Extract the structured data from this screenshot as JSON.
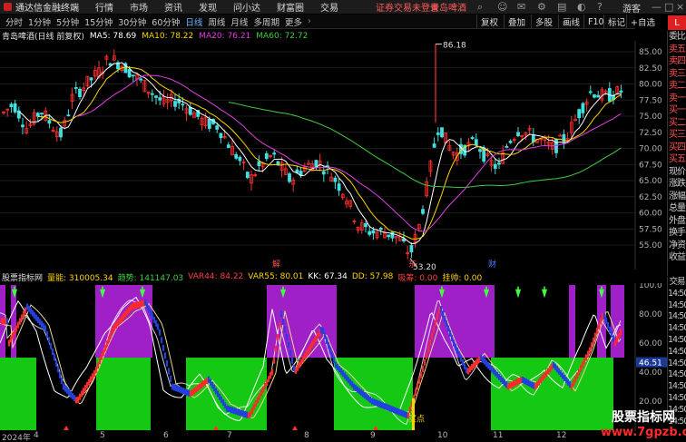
{
  "menubar": {
    "app_title": "通达信金融终端",
    "items": [
      "行情",
      "市场",
      "资讯",
      "发现",
      "问小达",
      "财富圈",
      "交易"
    ],
    "notice": "证券交易未登录",
    "stock_short": "青岛啤酒",
    "guest": "游客"
  },
  "toolbar": {
    "periods": [
      "分时",
      "1分钟",
      "5分钟",
      "15分钟",
      "30分钟",
      "60分钟",
      "日线",
      "周线",
      "月线",
      "多周期",
      "更多"
    ],
    "active_period": "日线",
    "right_buttons": [
      "复权",
      "叠加",
      "多股",
      "画线",
      "F10",
      "标记",
      "+自选"
    ]
  },
  "chart_info": {
    "stock_label": "青岛啤酒(日线 前复权)",
    "ma5": "MA5: 78.69",
    "ma10": "MA10: 78.22",
    "ma20": "MA20: 76.21",
    "ma60": "MA60: 72.72",
    "ma5_color": "#ffffff",
    "ma10_color": "#ffd400",
    "ma20_color": "#e040e0",
    "ma60_color": "#40d040"
  },
  "price_axis": [
    "85.00",
    "82.50",
    "80.00",
    "77.50",
    "75.00",
    "72.50",
    "70.00",
    "67.50",
    "65.00",
    "62.50",
    "60.00",
    "57.50",
    "55.00"
  ],
  "price_annotations": {
    "high": "86.18",
    "low": "53.20"
  },
  "event_markers": [
    "解",
    "东",
    "财"
  ],
  "indicator": {
    "name": "股票指标网",
    "values": [
      "量能: 310005.34",
      "趋势: 141147.03",
      "VAR44: 84.22",
      "VAR55: 80.01",
      "KK: 67.34",
      "DD: 57.98",
      "吸筹: 0.00",
      "挂帅: 0.00"
    ],
    "colors": [
      "#ffd400",
      "#40d040",
      "#ff4040",
      "#ffd400",
      "#ffffff",
      "#ffd400",
      "#ff4040",
      "#ffd400"
    ],
    "axis": [
      "100.0",
      "80.00",
      "60.00",
      "40.00",
      "20.00"
    ],
    "current_value": "46.51",
    "buy_label": "买点"
  },
  "date_axis": [
    "2024年",
    "4",
    "5",
    "6",
    "7",
    "8",
    "9",
    "10",
    "11",
    "12"
  ],
  "right_panel": [
    "委比",
    "卖五",
    "卖四",
    "卖三",
    "卖二",
    "卖一",
    "买一",
    "买二",
    "买三",
    "买四",
    "买五",
    "现价",
    "涨跌",
    "涨幅",
    "总量",
    "外盘",
    "换手",
    "净资",
    "收益"
  ],
  "right_panel2": [
    "交易",
    "14:50",
    "14:50",
    "14:50",
    "14:50",
    "14:50",
    "14:50",
    "14:50",
    "14:50",
    "14:50",
    "14:50",
    "14:50",
    "14:50"
  ],
  "watermark": {
    "line1": "股票指标网",
    "line2": "www.7gpzb.com"
  },
  "l_box": "L"
}
